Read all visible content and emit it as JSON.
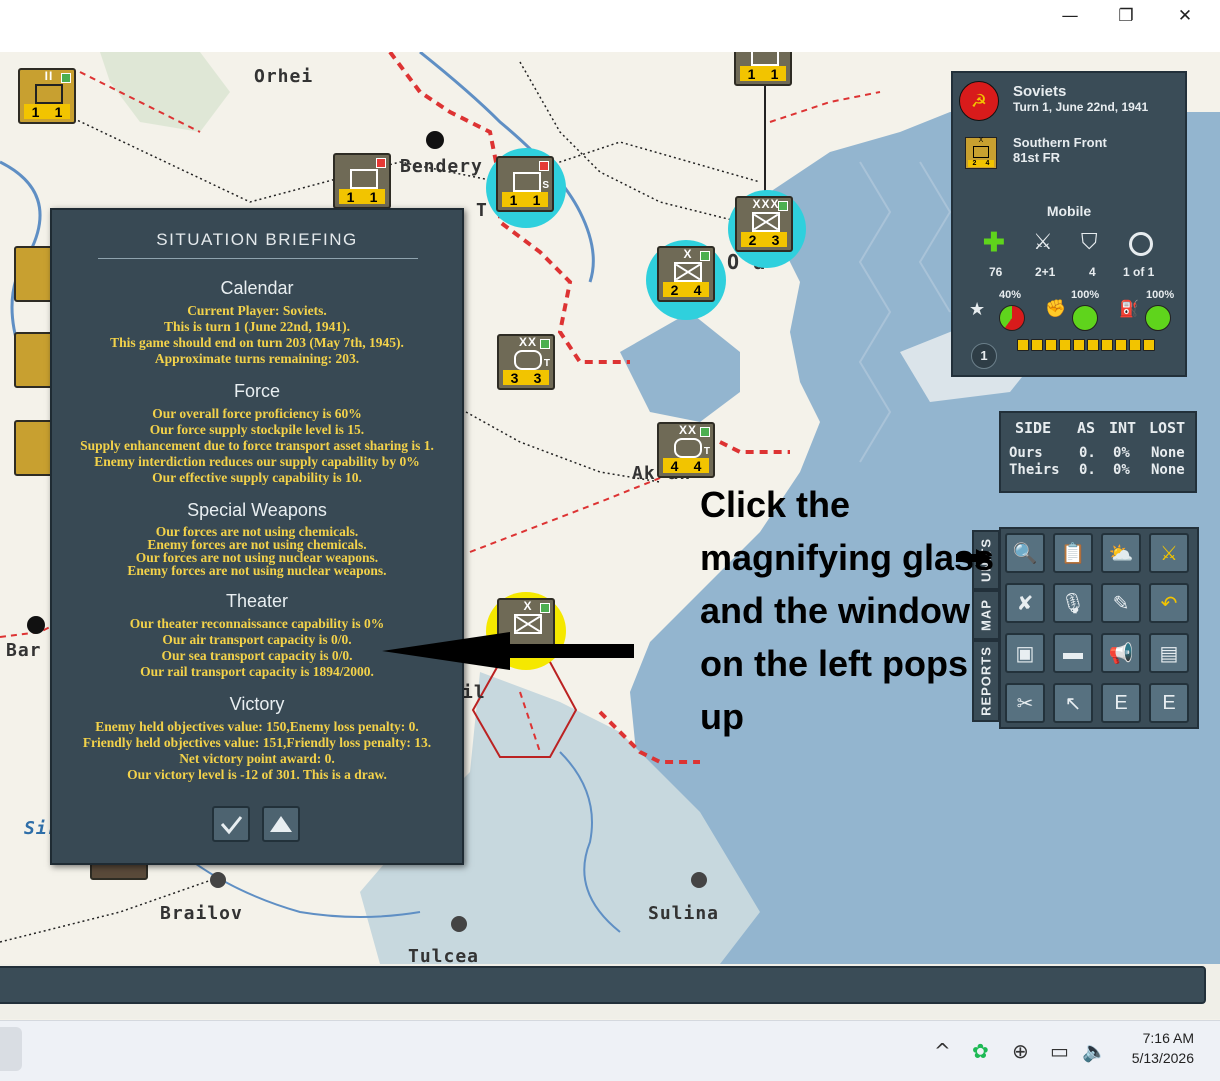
{
  "window": {
    "minimize_glyph": "—",
    "restore_glyph": "❐",
    "close_glyph": "✕"
  },
  "map": {
    "cities": {
      "orhei": "Orhei",
      "bendery": "Bendery",
      "tiraspol": "T       ol",
      "odessa": "O    a",
      "akkerman": "Ak      an",
      "brailov": "Brailov",
      "sulina": "Sulina",
      "tulcea": "Tulcea",
      "bar": "Bar",
      "sir": "Sir",
      "il": "il"
    },
    "counters": [
      {
        "size": "II",
        "left": "1",
        "right": "1"
      },
      {
        "size": "",
        "left": "1",
        "right": "1"
      },
      {
        "size": "",
        "left": "1",
        "right": "1"
      },
      {
        "size": "",
        "left": "1",
        "right": "1"
      },
      {
        "size": "XXX",
        "left": "2",
        "right": "3"
      },
      {
        "size": "X",
        "left": "2",
        "right": "4"
      },
      {
        "size": "XX",
        "left": "3",
        "right": "3"
      },
      {
        "size": "XX",
        "left": "4",
        "right": "4"
      },
      {
        "size": "X",
        "left": "",
        "right": ""
      }
    ],
    "counter_markers": {
      "s": "S",
      "t1": "T",
      "t2": "T"
    }
  },
  "briefing": {
    "title": "SITUATION BRIEFING",
    "calendar": {
      "heading": "Calendar",
      "lines": [
        "Current Player: Soviets.",
        "This is turn 1 (June 22nd, 1941).",
        "This game should end on turn 203 (May 7th, 1945).",
        "Approximate turns remaining: 203."
      ]
    },
    "force": {
      "heading": "Force",
      "lines": [
        "Our overall force proficiency is 60%",
        "Our force supply stockpile level is 15.",
        "Supply enhancement due to force transport asset sharing is 1.",
        "Enemy interdiction reduces our supply capability by 0%",
        "Our effective supply capability is 10."
      ]
    },
    "special": {
      "heading": "Special Weapons",
      "lines": [
        "Our forces are not using chemicals.",
        "Enemy forces are not using chemicals.",
        "Our forces are not using nuclear weapons.",
        "Enemy forces are not using nuclear weapons."
      ]
    },
    "theater": {
      "heading": "Theater",
      "lines": [
        "Our theater reconnaissance capability is 0%",
        "Our air transport capacity is 0/0.",
        "Our sea transport capacity is 0/0.",
        "Our rail transport capacity is 1894/2000."
      ]
    },
    "victory": {
      "heading": "Victory",
      "lines": [
        "Enemy held objectives value: 150,Enemy loss penalty: 0.",
        "Friendly held objectives value: 151,Friendly loss penalty: 13.",
        "Net victory point award: 0.",
        "Our victory level is -12 of 301. This is a draw."
      ]
    }
  },
  "side_panel": {
    "faction": "Soviets",
    "turn": "Turn 1, June 22nd, 1941",
    "unit_front": "Southern Front",
    "unit_name": "81st FR",
    "unit_size_mark": "X",
    "unit_left": "2",
    "unit_right": "4",
    "mode": "Mobile",
    "stats": [
      "76",
      "2+1",
      "4",
      "1 of 1"
    ],
    "pcts": [
      "40%",
      "100%",
      "100%"
    ],
    "level": "1",
    "steps": 10,
    "colors": {
      "red": "#d81b1b",
      "green": "#5fd41c",
      "gold": "#f2c400"
    }
  },
  "loss_table": {
    "headers": [
      "SIDE",
      "AS",
      "INT",
      "LOST"
    ],
    "rows": [
      [
        "Ours",
        "0.",
        "0%",
        "None"
      ],
      [
        "Theirs",
        "0.",
        "0%",
        "None"
      ]
    ]
  },
  "tabs": {
    "units": "UNITS",
    "map": "MAP",
    "reports": "REPORTS"
  },
  "tools": [
    "magnifier-icon",
    "clipboard-icon",
    "weather-icon",
    "crossed-swords-icon",
    "no-attack-icon",
    "microphone-icon",
    "no-edit-icon",
    "undo-icon",
    "armor-icon",
    "tank-icon",
    "megaphone-icon",
    "view-icon",
    "cut-icon",
    "arrow-icon",
    "grid-e-icon",
    "exit-e-icon"
  ],
  "tool_glyphs": [
    "🔍",
    "📋",
    "⛅",
    "⚔",
    "✘",
    "🎙",
    "✎",
    "↶",
    "▣",
    "▬",
    "📢",
    "▤",
    "✂",
    "↖",
    "E",
    "E"
  ],
  "instruction": "Click the magnifying glass and the window on the left pops up",
  "taskbar": {
    "time": "7:16 AM",
    "date": "5/13/2026",
    "caret": "^"
  }
}
